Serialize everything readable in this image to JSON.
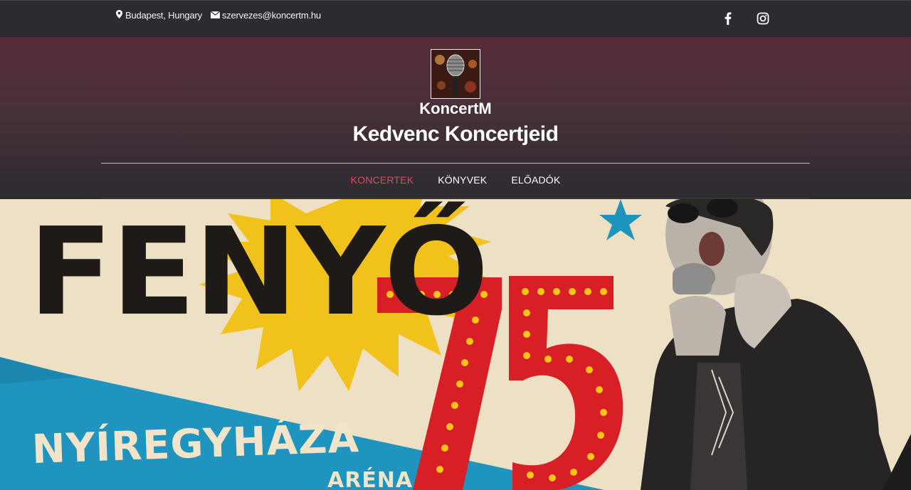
{
  "topbar": {
    "location": "Budapest, Hungary",
    "email": "szervezes@koncertm.hu",
    "social": [
      "facebook-icon",
      "instagram-icon"
    ]
  },
  "header": {
    "brand": "KoncertM",
    "tagline": "Kedvenc Koncertjeid"
  },
  "nav": {
    "items": [
      {
        "label": "KONCERTEK",
        "active": true
      },
      {
        "label": "KÖNYVEK",
        "active": false
      },
      {
        "label": "ELŐADÓK",
        "active": false
      }
    ]
  },
  "banner": {
    "artist": "FENYŐ",
    "number": "75",
    "city": "NYÍREGYHÁZA",
    "venue": "ARÉNA"
  },
  "colors": {
    "accent": "#e04a5b",
    "topbar": "#2d2b31",
    "header_top": "#562b38"
  }
}
